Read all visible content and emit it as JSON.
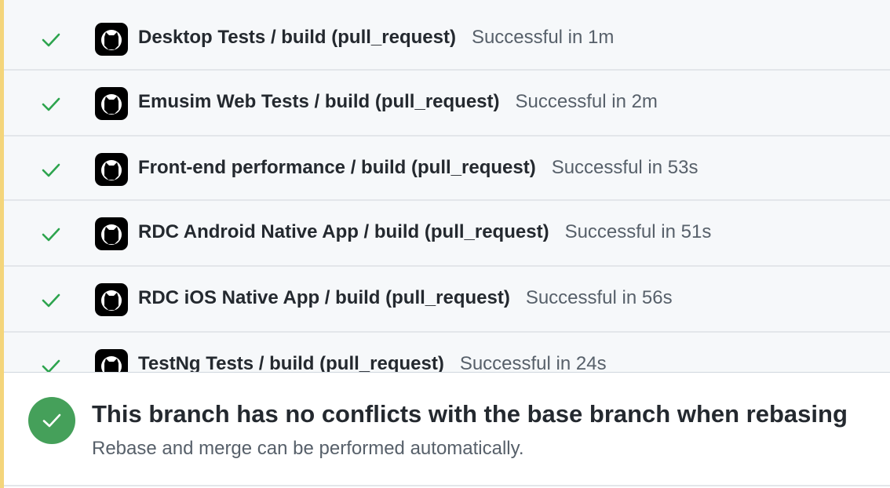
{
  "checks": [
    {
      "name": "Desktop Tests / build (pull_request)",
      "status": "Successful in 1m",
      "state": "success",
      "icon": "github-actions-icon"
    },
    {
      "name": "Emusim Web Tests / build (pull_request)",
      "status": "Successful in 2m",
      "state": "success",
      "icon": "github-actions-icon"
    },
    {
      "name": "Front-end performance / build (pull_request)",
      "status": "Successful in 53s",
      "state": "success",
      "icon": "github-actions-icon"
    },
    {
      "name": "RDC Android Native App / build (pull_request)",
      "status": "Successful in 51s",
      "state": "success",
      "icon": "github-actions-icon"
    },
    {
      "name": "RDC iOS Native App / build (pull_request)",
      "status": "Successful in 56s",
      "state": "success",
      "icon": "github-actions-icon"
    },
    {
      "name": "TestNg Tests / build (pull_request)",
      "status": "Successful in 24s",
      "state": "success",
      "icon": "github-actions-icon"
    }
  ],
  "merge_status": {
    "title": "This branch has no conflicts with the base branch when rebasing",
    "subtitle": "Rebase and merge can be performed automatically.",
    "icon": "check-circle-icon"
  },
  "colors": {
    "success": "#2da44e",
    "success_badge": "#45a05a",
    "accent_bar": "#f4d57b",
    "panel_background": "#f6f8fa"
  }
}
